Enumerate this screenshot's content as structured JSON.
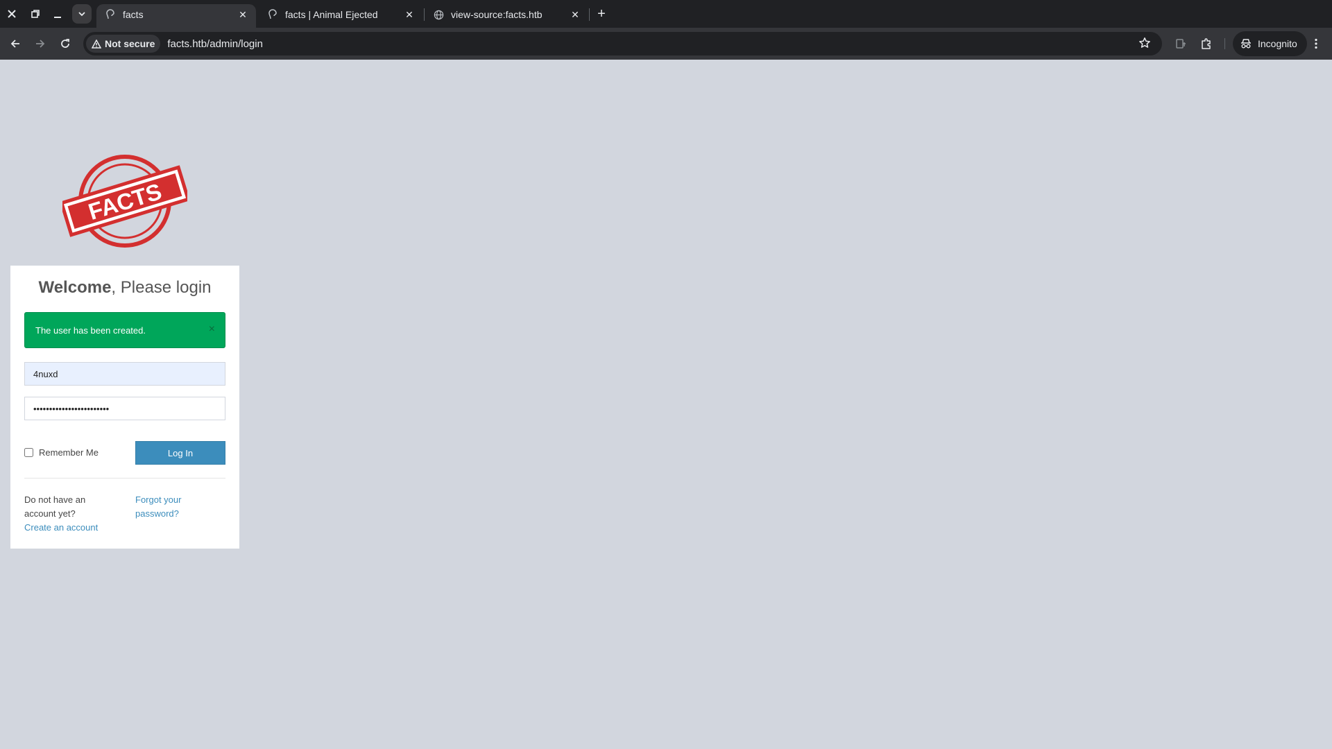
{
  "browser": {
    "tabs": [
      {
        "title": "facts",
        "active": true,
        "favicon": "facts-favicon-icon"
      },
      {
        "title": "facts | Animal Ejected",
        "active": false,
        "favicon": "facts-favicon-icon"
      },
      {
        "title": "view-source:facts.htb",
        "active": false,
        "favicon": "globe-icon"
      }
    ],
    "security_label": "Not secure",
    "url": "facts.htb/admin/login",
    "profile_label": "Incognito"
  },
  "logo": {
    "text": "FACTS",
    "color": "#d32f2f"
  },
  "login": {
    "title_bold": "Welcome",
    "title_rest": ", Please login",
    "alert": {
      "message": "The user has been created.",
      "close": "×",
      "color": "#00a65a"
    },
    "username_value": "4nuxd",
    "password_value": "••••••••••••••••••••••••",
    "remember_label": "Remember Me",
    "login_button": "Log In",
    "no_account_text": "Do not have an account yet?",
    "create_account_link": "Create an account",
    "forgot_password_link": "Forgot your password?"
  },
  "colors": {
    "accent": "#3c8dbc",
    "page_bg": "#d2d6de"
  }
}
